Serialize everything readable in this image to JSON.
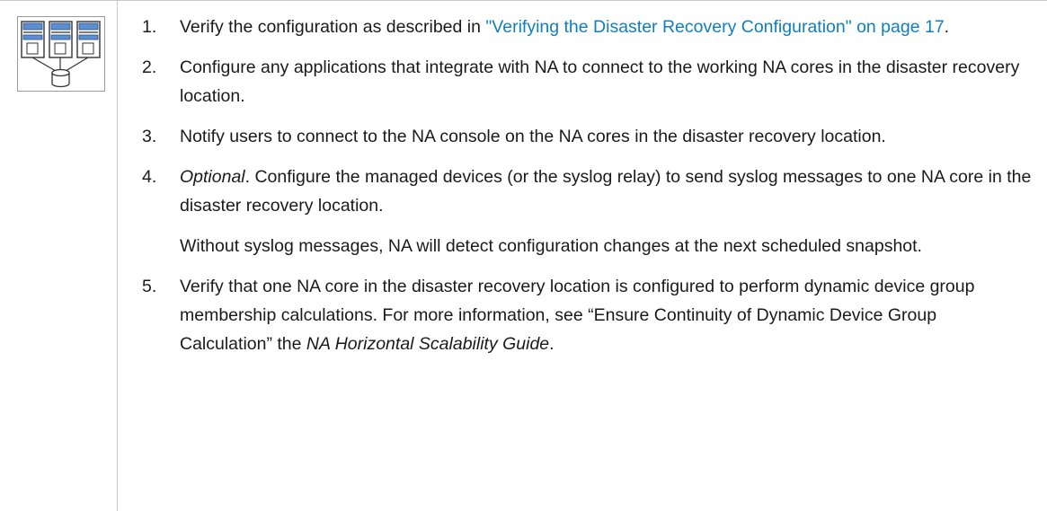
{
  "icon": "server-database-diagram-icon",
  "colors": {
    "link": "#0f7fbf",
    "text": "#1a1a1a",
    "rule": "#c8c8c8"
  },
  "steps": [
    {
      "number": "1.",
      "text_before": "Verify the configuration as described in ",
      "link": "\"Verifying the Disaster Recovery Configuration\" on page 17",
      "text_after": "."
    },
    {
      "number": "2.",
      "text": "Configure any applications that integrate with NA to connect to the working NA cores in the disaster recovery location."
    },
    {
      "number": "3.",
      "text": "Notify users to connect to the NA console on the NA cores in the disaster recovery location."
    },
    {
      "number": "4.",
      "optional": "Optional",
      "text": ". Configure the managed devices (or the syslog relay) to send syslog messages to one NA core in the disaster recovery location.",
      "note": "Without syslog messages, NA will detect configuration changes at the next scheduled snapshot."
    },
    {
      "number": "5.",
      "text_before": "Verify that one NA core in the disaster recovery location is configured to perform dynamic device group membership calculations. For more information, see “Ensure Continuity of Dynamic Device Group Calculation” the ",
      "guide": "NA Horizontal Scalability Guide",
      "text_after": "."
    }
  ]
}
